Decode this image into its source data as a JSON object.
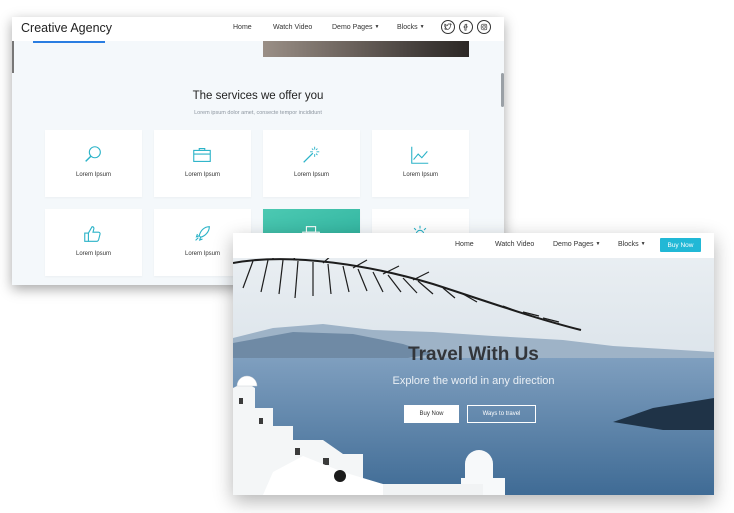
{
  "agency": {
    "brand": "Creative Agency",
    "nav": [
      "Home",
      "Watch Video",
      "Demo Pages",
      "Blocks"
    ],
    "social_icons": [
      "twitter-icon",
      "facebook-icon",
      "instagram-icon"
    ],
    "services": {
      "title": "The services we offer you",
      "subtitle": "Lorem ipsum dolor amet, consecte tempor incididunt",
      "cards": [
        {
          "label": "Lorem Ipsum",
          "icon": "magnifier-icon"
        },
        {
          "label": "Lorem Ipsum",
          "icon": "briefcase-icon"
        },
        {
          "label": "Lorem Ipsum",
          "icon": "magic-wand-icon"
        },
        {
          "label": "Lorem Ipsum",
          "icon": "line-chart-icon"
        },
        {
          "label": "Lorem Ipsum",
          "icon": "thumbs-up-icon"
        },
        {
          "label": "Lorem Ipsum",
          "icon": "rocket-icon"
        },
        {
          "label": "",
          "icon": "printer-icon"
        },
        {
          "label": "",
          "icon": "gear-icon"
        }
      ]
    },
    "accent": "#2a7de1",
    "highlight_card": "#3dbfa8"
  },
  "travel": {
    "nav": [
      "Home",
      "Watch Video",
      "Demo Pages",
      "Blocks"
    ],
    "buy_now_nav": "Buy Now",
    "hero_title": "Travel With Us",
    "hero_subtitle": "Explore the world in any direction",
    "buy_button": "Buy Now",
    "ways_button": "Ways to travel",
    "accent": "#21b8d6"
  }
}
